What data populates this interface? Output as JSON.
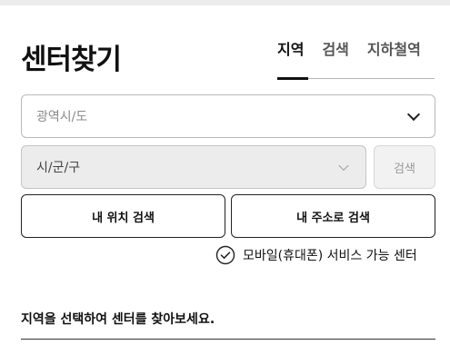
{
  "header": {
    "title": "센터찾기"
  },
  "tabs": [
    {
      "label": "지역",
      "active": true
    },
    {
      "label": "검색",
      "active": false
    },
    {
      "label": "지하철역",
      "active": false
    }
  ],
  "filters": {
    "region_placeholder": "광역시/도",
    "city_placeholder": "시/군/구",
    "search_label": "검색"
  },
  "buttons": {
    "my_location": "내 위치 검색",
    "by_address": "내 주소로 검색"
  },
  "mobile_option": {
    "label": "모바일(휴대폰) 서비스 가능 센터",
    "checked": false
  },
  "result_hint": "지역을 선택하여 센터를 찾아보세요.",
  "colors": {
    "text": "#111111",
    "border": "#b9b9b9",
    "disabled_bg": "#ececec"
  }
}
